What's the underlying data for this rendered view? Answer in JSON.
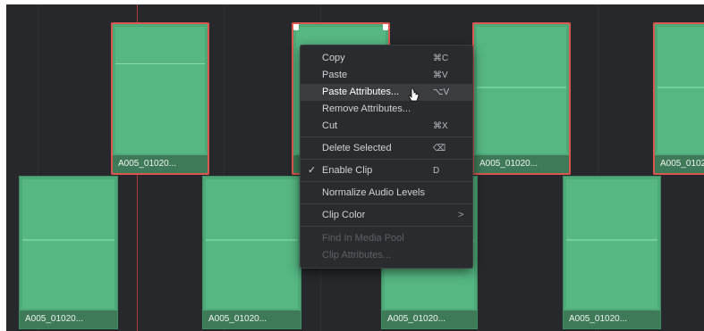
{
  "timeline": {
    "clips": [
      {
        "name": "A005_01020..."
      },
      {
        "name": ""
      },
      {
        "name": "A005_01020..."
      },
      {
        "name": "A005_0102"
      },
      {
        "name": "A005_01020..."
      },
      {
        "name": "A005_01020..."
      },
      {
        "name": "A005_01020..."
      },
      {
        "name": "A005_01020..."
      }
    ]
  },
  "context_menu": {
    "copy": {
      "label": "Copy",
      "shortcut": "⌘C"
    },
    "paste": {
      "label": "Paste",
      "shortcut": "⌘V"
    },
    "paste_attributes": {
      "label": "Paste Attributes...",
      "shortcut": "⌥V"
    },
    "remove_attributes": {
      "label": "Remove Attributes..."
    },
    "cut": {
      "label": "Cut",
      "shortcut": "⌘X"
    },
    "delete_selected": {
      "label": "Delete Selected",
      "shortcut": "⌫"
    },
    "enable_clip": {
      "label": "Enable Clip",
      "shortcut": "D",
      "check": "✓"
    },
    "normalize_audio": {
      "label": "Normalize Audio Levels"
    },
    "clip_color": {
      "label": "Clip Color",
      "arrow": ">"
    },
    "find_in_media_pool": {
      "label": "Find In Media Pool"
    },
    "clip_attributes": {
      "label": "Clip Attributes..."
    }
  },
  "colors": {
    "clip_green": "#4ea878",
    "selection_red": "#d9574f",
    "background": "#26282b"
  }
}
